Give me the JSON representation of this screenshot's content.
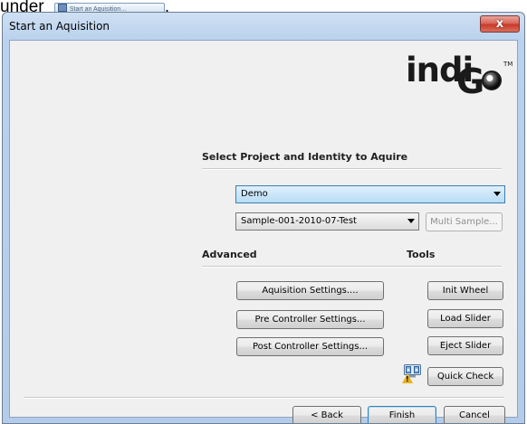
{
  "caption": {
    "text": "under",
    "mini_button_label": "Start an Aquisition...",
    "trailing": "."
  },
  "window": {
    "title": "Start an Aquisition",
    "close_glyph": "x"
  },
  "logo": {
    "part1": "indi",
    "part2": "G",
    "trademark": "TM"
  },
  "select_section": {
    "heading": "Select Project and Identity to Aquire",
    "project_value": "Demo",
    "sample_value": "Sample-001-2010-07-Test",
    "multi_sample_label": "Multi Sample..."
  },
  "advanced": {
    "heading": "Advanced",
    "aquisition_settings": "Aquisition Settings....",
    "pre_controller_settings": "Pre Controller Settings...",
    "post_controller_settings": "Post Controller Settings..."
  },
  "tools": {
    "heading": "Tools",
    "init_wheel": "Init Wheel",
    "load_slider": "Load Slider",
    "eject_slider": "Eject Slider",
    "quick_check": "Quick Check"
  },
  "footer": {
    "back": "< Back",
    "finish": "Finish",
    "cancel": "Cancel"
  },
  "icons": {
    "close": "close-icon",
    "dropdown": "chevron-down-icon",
    "status": "computer-icon",
    "warning": "warning-icon",
    "window_app": "window-icon"
  },
  "colors": {
    "frame": "#b3cce9",
    "client": "#f0f0f0",
    "close_button": "#c73a27",
    "combo_focus": "#b9dcf6",
    "default_button_border": "#3c7fb1",
    "warning": "#e5b21b"
  }
}
